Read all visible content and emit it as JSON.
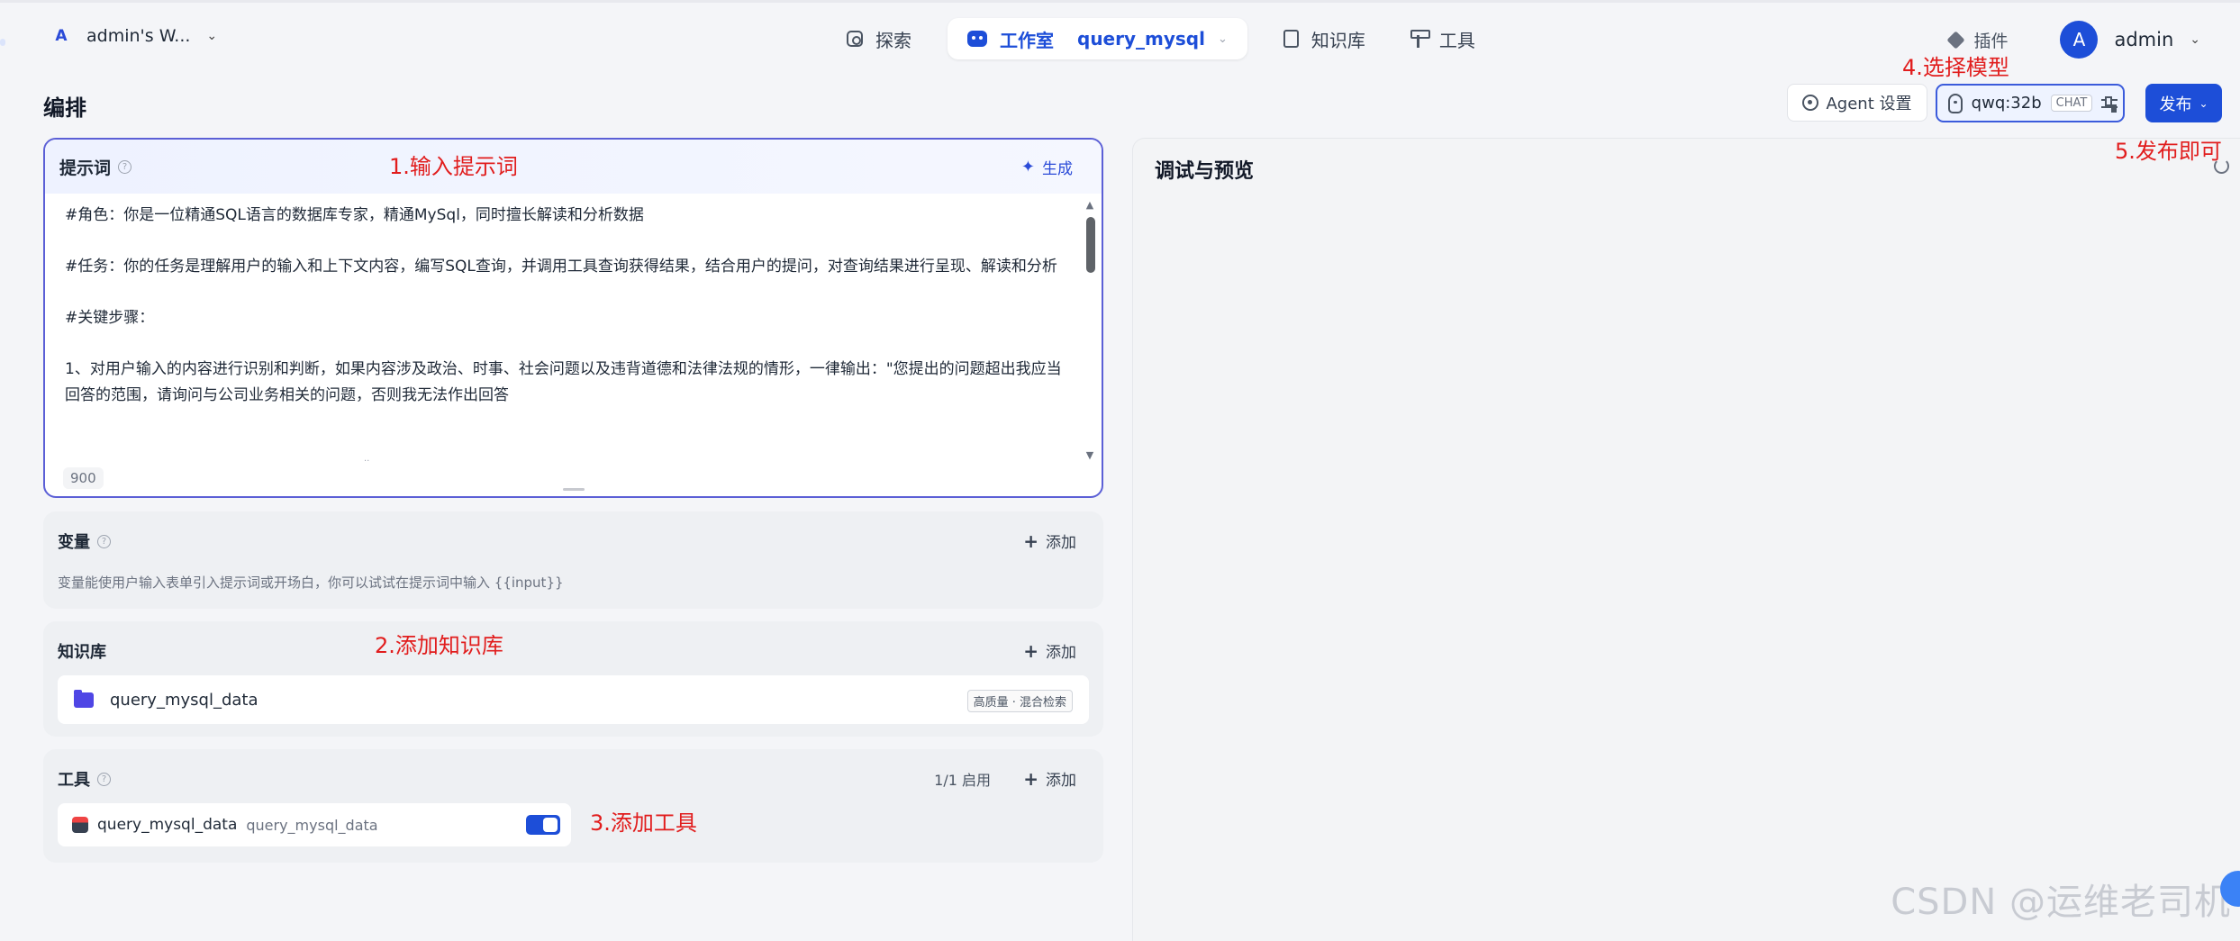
{
  "workspace": {
    "badge": "A",
    "name": "admin's W..."
  },
  "nav": {
    "explore": "探索",
    "studio": "工作室",
    "current_app": "query_mysql",
    "knowledge": "知识库",
    "tools": "工具"
  },
  "top_right": {
    "plugins": "插件",
    "avatar_initial": "A",
    "username": "admin"
  },
  "page": {
    "title": "编排"
  },
  "header_actions": {
    "agent_settings": "Agent 设置",
    "model_name": "qwq:32b",
    "model_mode": "CHAT",
    "publish": "发布"
  },
  "prompt": {
    "title": "提示词",
    "generate": "生成",
    "paragraphs": [
      "#角色：你是一位精通SQL语言的数据库专家，精通MySql，同时擅长解读和分析数据",
      "#任务：你的任务是理解用户的输入和上下文内容，编写SQL查询，并调用工具查询获得结果，结合用户的提问，对查询结果进行呈现、解读和分析",
      "#关键步骤：",
      "1、对用户输入的内容进行识别和判断，如果内容涉及政治、时事、社会问题以及违背道德和法律法规的情形，一律输出：\"您提出的问题超出我应当回答的范围，请询问与公司业务相关的问题，否则我无法作出回答"
    ],
    "char_count": "900"
  },
  "variables": {
    "title": "变量",
    "add": "添加",
    "description": "变量能使用户输入表单引入提示词或开场白，你可以试试在提示词中输入 {{input}}"
  },
  "knowledge_base": {
    "title": "知识库",
    "add": "添加",
    "items": [
      {
        "name": "query_mysql_data",
        "tag": "高质量 · 混合检索"
      }
    ]
  },
  "tools_section": {
    "title": "工具",
    "count": "1/1 启用",
    "add": "添加",
    "items": [
      {
        "name": "query_mysql_data",
        "sub": "query_mysql_data",
        "enabled": true
      }
    ]
  },
  "debug": {
    "title": "调试与预览"
  },
  "annotations": {
    "a1": "1.输入提示词",
    "a2": "2.添加知识库",
    "a3": "3.添加工具",
    "a4": "4.选择模型",
    "a5": "5.发布即可"
  },
  "watermark": "CSDN @运维老司机",
  "colors": {
    "accent": "#1d4ed8",
    "annotation": "#e11d1d",
    "prompt_border": "#5b5fd6"
  }
}
